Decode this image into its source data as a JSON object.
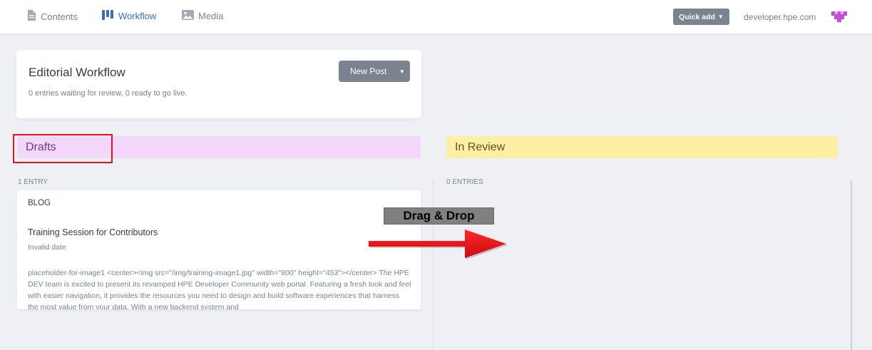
{
  "nav": {
    "items": [
      {
        "label": "Contents",
        "icon": "document-icon"
      },
      {
        "label": "Workflow",
        "icon": "workflow-icon",
        "active": true
      },
      {
        "label": "Media",
        "icon": "image-icon"
      }
    ],
    "quick_add": "Quick add",
    "site": "developer.hpe.com",
    "accent": "#3a69c7"
  },
  "workflow": {
    "title": "Editorial Workflow",
    "summary": "0 entries waiting for review, 0 ready to go live.",
    "new_post": "New Post"
  },
  "columns": {
    "drafts": {
      "title": "Drafts",
      "count": "1 ENTRY",
      "color": "#f2d7fb",
      "entries": [
        {
          "collection": "BLOG",
          "title": "Training Session for Contributors",
          "date": "Invalid date",
          "body": "placeholder-for-image1 <center><img src=\"/img/training-image1.jpg\" width=\"800\" height=\"453\"></center> The HPE DEV team is excited to present its revamped HPE Developer Community web portal. Featuring a fresh look and feel with easier navigation, it provides the resources you need to design and build software experiences that harness the most value from your data. With a new backend system and"
        }
      ]
    },
    "in_review": {
      "title": "In Review",
      "count": "0 ENTRIES",
      "color": "#fdf0a4"
    }
  },
  "annotation": {
    "label": "Drag & Drop",
    "arrow_color": "#e8151c",
    "highlight_color": "#e3141b"
  }
}
